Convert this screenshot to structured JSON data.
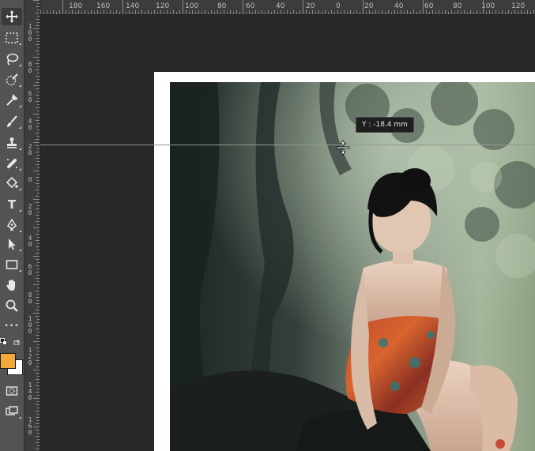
{
  "toolbar": {
    "tools": [
      {
        "name": "move-tool",
        "icon": "move-icon",
        "active": true
      },
      {
        "name": "marquee-tool",
        "icon": "rect-marquee-icon"
      },
      {
        "name": "lasso-tool",
        "icon": "lasso-icon"
      },
      {
        "name": "quick-select-tool",
        "icon": "quick-select-icon"
      },
      {
        "name": "eyedropper-tool",
        "icon": "eyedropper-icon"
      },
      {
        "name": "brush-tool",
        "icon": "brush-icon"
      },
      {
        "name": "stamp-tool",
        "icon": "stamp-icon"
      },
      {
        "name": "healing-tool",
        "icon": "healing-icon"
      },
      {
        "name": "paint-bucket-tool",
        "icon": "paint-bucket-icon"
      },
      {
        "name": "type-tool",
        "icon": "type-icon",
        "glyph": "T"
      },
      {
        "name": "pen-tool",
        "icon": "pen-icon"
      },
      {
        "name": "path-select-tool",
        "icon": "arrow-icon"
      },
      {
        "name": "shape-tool",
        "icon": "rectangle-icon"
      },
      {
        "name": "hand-tool",
        "icon": "hand-icon"
      },
      {
        "name": "zoom-tool",
        "icon": "zoom-icon"
      },
      {
        "name": "more-tools",
        "icon": "ellipsis-icon",
        "glyph": "•••"
      }
    ],
    "foreground_color": "#f5a83a",
    "background_color": "#ffffff",
    "quick-mask": "quick-mask-icon",
    "screen-mode": "screen-mode-icon"
  },
  "ruler_top": {
    "labels": [
      "180",
      "160",
      "140",
      "120",
      "100",
      "80",
      "60",
      "40",
      "20",
      "0",
      "20",
      "40",
      "60",
      "80",
      "100",
      "120"
    ]
  },
  "ruler_left": {
    "labels": [
      "1\n0\n0",
      "8\n0",
      "6\n0",
      "4\n0",
      "2\n0",
      "0",
      "2\n0",
      "4\n0",
      "6\n0",
      "8\n0",
      "1\n0\n0",
      "1\n2\n0",
      "1\n4\n0",
      "1\n6\n0"
    ]
  },
  "guide": {
    "tooltip": "Y :   -18.4 mm"
  }
}
